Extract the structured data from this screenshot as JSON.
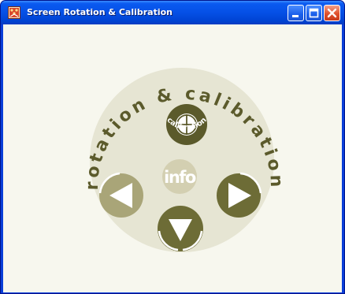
{
  "window": {
    "title": "Screen Rotation & Calibration"
  },
  "dial": {
    "arc_text": "rotation & calibration",
    "calibration_label": "calibration",
    "info_label": "info"
  },
  "colors": {
    "titlebar_blue": "#0550e6",
    "close_red": "#e0502c",
    "client_bg": "#f7f7ee",
    "dial_bg": "#e6e5d3",
    "olive_dark": "#5b5a2b",
    "olive_mid": "#6d6c36",
    "olive_light": "#a9a578",
    "info_circle": "#d3cfb1"
  },
  "icons": {
    "app": "rotation-app-icon",
    "minimize": "minimize-icon",
    "maximize": "maximize-icon",
    "close": "close-icon",
    "calibration": "crosshair-icon",
    "rotate_left": "arrow-left-icon",
    "rotate_right": "arrow-right-icon",
    "rotate_down": "arrow-down-icon"
  }
}
